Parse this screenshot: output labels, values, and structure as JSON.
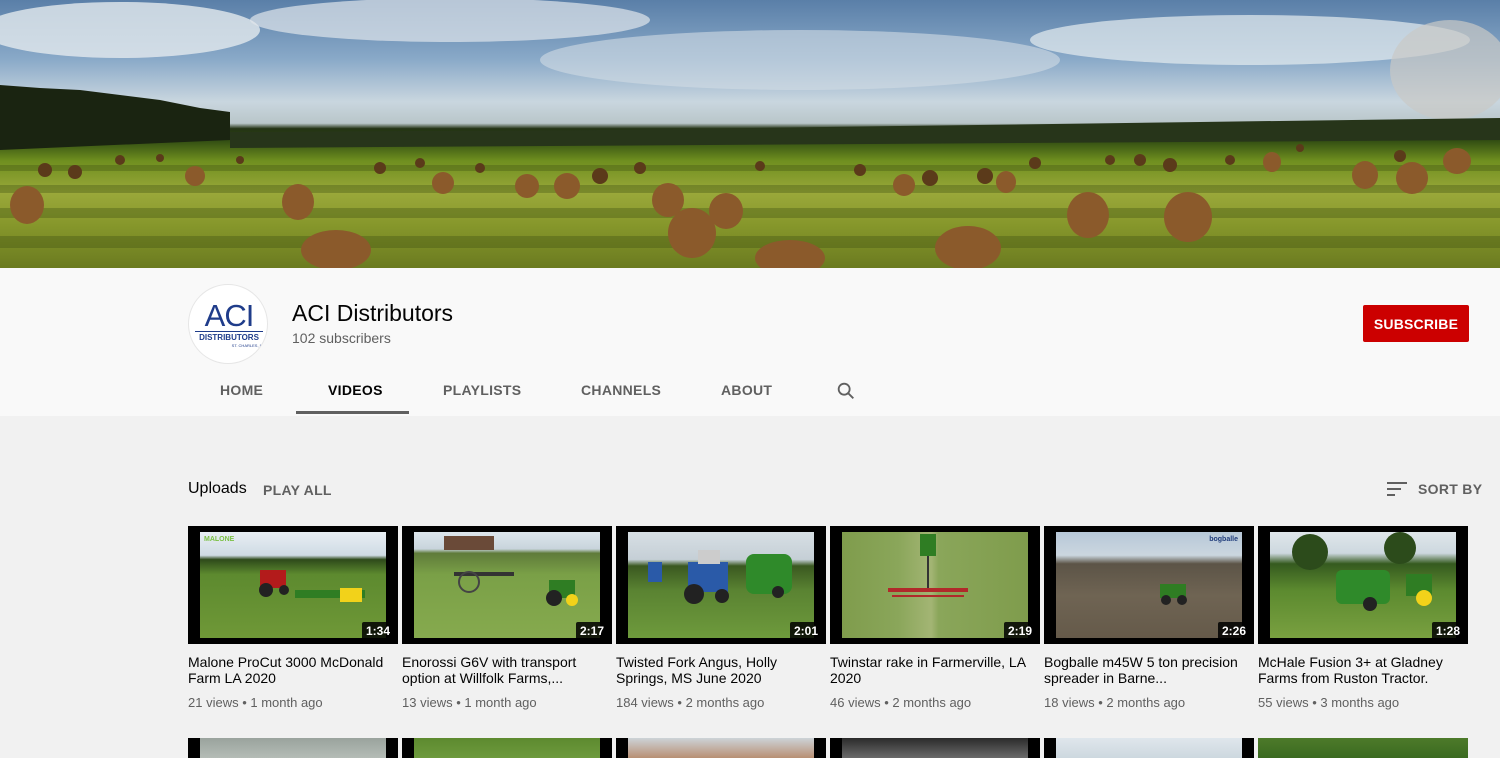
{
  "channel": {
    "name": "ACI Distributors",
    "subscribers": "102 subscribers",
    "subscribe_label": "SUBSCRIBE",
    "logo": {
      "main": "ACI",
      "sub": "DISTRIBUTORS",
      "city": "ST. CHARLES, M"
    }
  },
  "tabs": [
    {
      "label": "HOME",
      "active": false
    },
    {
      "label": "VIDEOS",
      "active": true
    },
    {
      "label": "PLAYLISTS",
      "active": false
    },
    {
      "label": "CHANNELS",
      "active": false
    },
    {
      "label": "ABOUT",
      "active": false
    }
  ],
  "icons": {
    "tab_search": "search-icon",
    "sort": "sort-icon"
  },
  "section": {
    "title": "Uploads",
    "play_all": "PLAY ALL",
    "sort_label": "SORT BY"
  },
  "videos": [
    {
      "title": "Malone ProCut 3000 McDonald Farm LA 2020",
      "duration": "1:34",
      "views": "21 views",
      "age": "1 month ago",
      "brand_text": "MALONE"
    },
    {
      "title": "Enorossi G6V with transport option at Willfolk Farms,...",
      "duration": "2:17",
      "views": "13 views",
      "age": "1 month ago",
      "brand_text": ""
    },
    {
      "title": "Twisted Fork Angus, Holly Springs, MS June 2020",
      "duration": "2:01",
      "views": "184 views",
      "age": "2 months ago",
      "brand_text": ""
    },
    {
      "title": "Twinstar rake in Farmerville, LA 2020",
      "duration": "2:19",
      "views": "46 views",
      "age": "2 months ago",
      "brand_text": ""
    },
    {
      "title": "Bogballe m45W 5 ton precision spreader in Barne...",
      "duration": "2:26",
      "views": "18 views",
      "age": "2 months ago",
      "brand_text": "bogballe"
    },
    {
      "title": "McHale Fusion 3+ at Gladney Farms from Ruston Tractor.",
      "duration": "1:28",
      "views": "55 views",
      "age": "3 months ago",
      "brand_text": ""
    }
  ],
  "colors": {
    "subscribe_bg": "#cc0000",
    "page_bg": "#f1f1f1",
    "header_bg": "#f9f9f9",
    "logo_blue": "#1f3c8a"
  }
}
